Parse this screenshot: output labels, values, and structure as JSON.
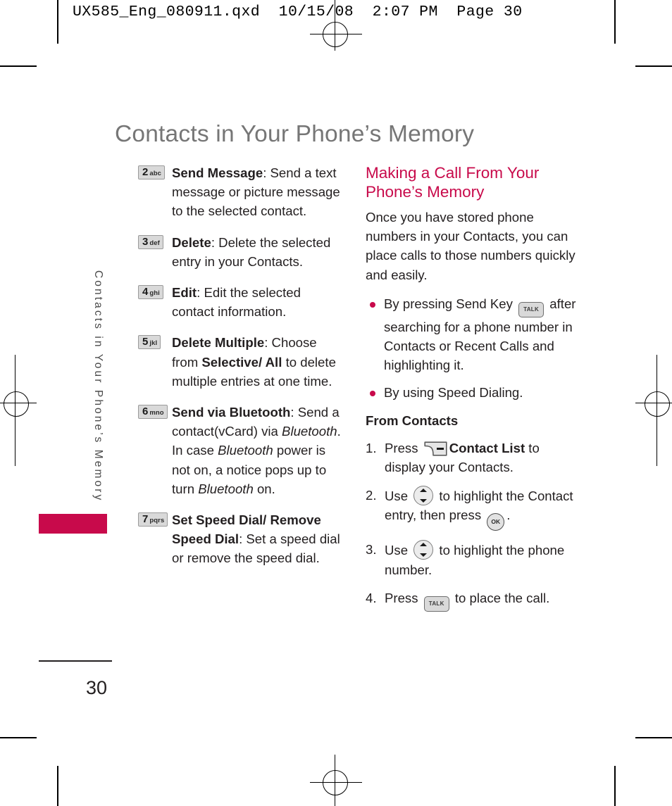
{
  "running_head": "UX585_Eng_080911.qxd  10/15/08  2:07 PM  Page 30",
  "page_title": "Contacts in Your Phone’s Memory",
  "side_tab": {
    "label": "Contacts in Your Phone’s Memory"
  },
  "footer": {
    "page_number": "30"
  },
  "colors": {
    "accent": "#c80a4b",
    "title_gray": "#767676",
    "body": "#231f20",
    "key_face": "#d9d9d9"
  },
  "left_column": {
    "items": [
      {
        "key_number": "2",
        "key_letters": "abc",
        "title": "Send Message",
        "body": ": Send a text message or picture message to the selected contact."
      },
      {
        "key_number": "3",
        "key_letters": "def",
        "title": "Delete",
        "body": ": Delete the selected entry in your Contacts."
      },
      {
        "key_number": "4",
        "key_letters": "ghi",
        "title": "Edit",
        "body": ": Edit the selected contact information."
      },
      {
        "key_number": "5",
        "key_letters": "jkl",
        "title": "Delete Multiple",
        "body_1": ": Choose from ",
        "emph_1": "Selective/ All",
        "body_2": " to delete multiple entries at one time."
      },
      {
        "key_number": "6",
        "key_letters": "mno",
        "title": "Send via Bluetooth",
        "body_1": ": Send a contact(vCard) via ",
        "italic_1": "Bluetooth",
        "body_2": ". In case ",
        "italic_2": "Bluetooth",
        "body_3": " power is not on, a notice pops up to turn ",
        "italic_3": "Bluetooth",
        "body_4": " on."
      },
      {
        "key_number": "7",
        "key_letters": "pqrs",
        "title": "Set Speed Dial/ Remove Speed Dial",
        "body": ": Set a speed dial or remove the speed dial."
      }
    ]
  },
  "right_column": {
    "section_heading": "Making a Call From Your Phone’s Memory",
    "intro": "Once you have stored phone numbers in your Contacts, you can place calls to those numbers quickly and easily.",
    "bullets": [
      {
        "text_1": "By pressing Send Key ",
        "key_icon": "talk-key",
        "key_label": "TALK",
        "text_2": " after searching for a phone number in Contacts or Recent Calls and highlighting it."
      },
      {
        "text_1": "By using Speed Dialing.",
        "key_icon": "",
        "key_label": "",
        "text_2": ""
      }
    ],
    "subhead": "From Contacts",
    "steps": [
      {
        "number": "1.",
        "text_1": "Press ",
        "key_icon": "left-soft-key",
        "key_label": "",
        "bold": "Contact List",
        "text_2": " to display your Contacts."
      },
      {
        "number": "2.",
        "text_1": "Use ",
        "key_icon": "nav-updown-key",
        "key_label": "",
        "text_2": " to highlight the Contact entry, then press ",
        "key_icon_2": "ok-key",
        "key_label_2": "OK",
        "text_3": "."
      },
      {
        "number": "3.",
        "text_1": "Use ",
        "key_icon": "nav-updown-key",
        "key_label": "",
        "text_2": " to highlight the phone number."
      },
      {
        "number": "4.",
        "text_1": "Press ",
        "key_icon": "talk-key",
        "key_label": "TALK",
        "text_2": " to place the call."
      }
    ]
  }
}
